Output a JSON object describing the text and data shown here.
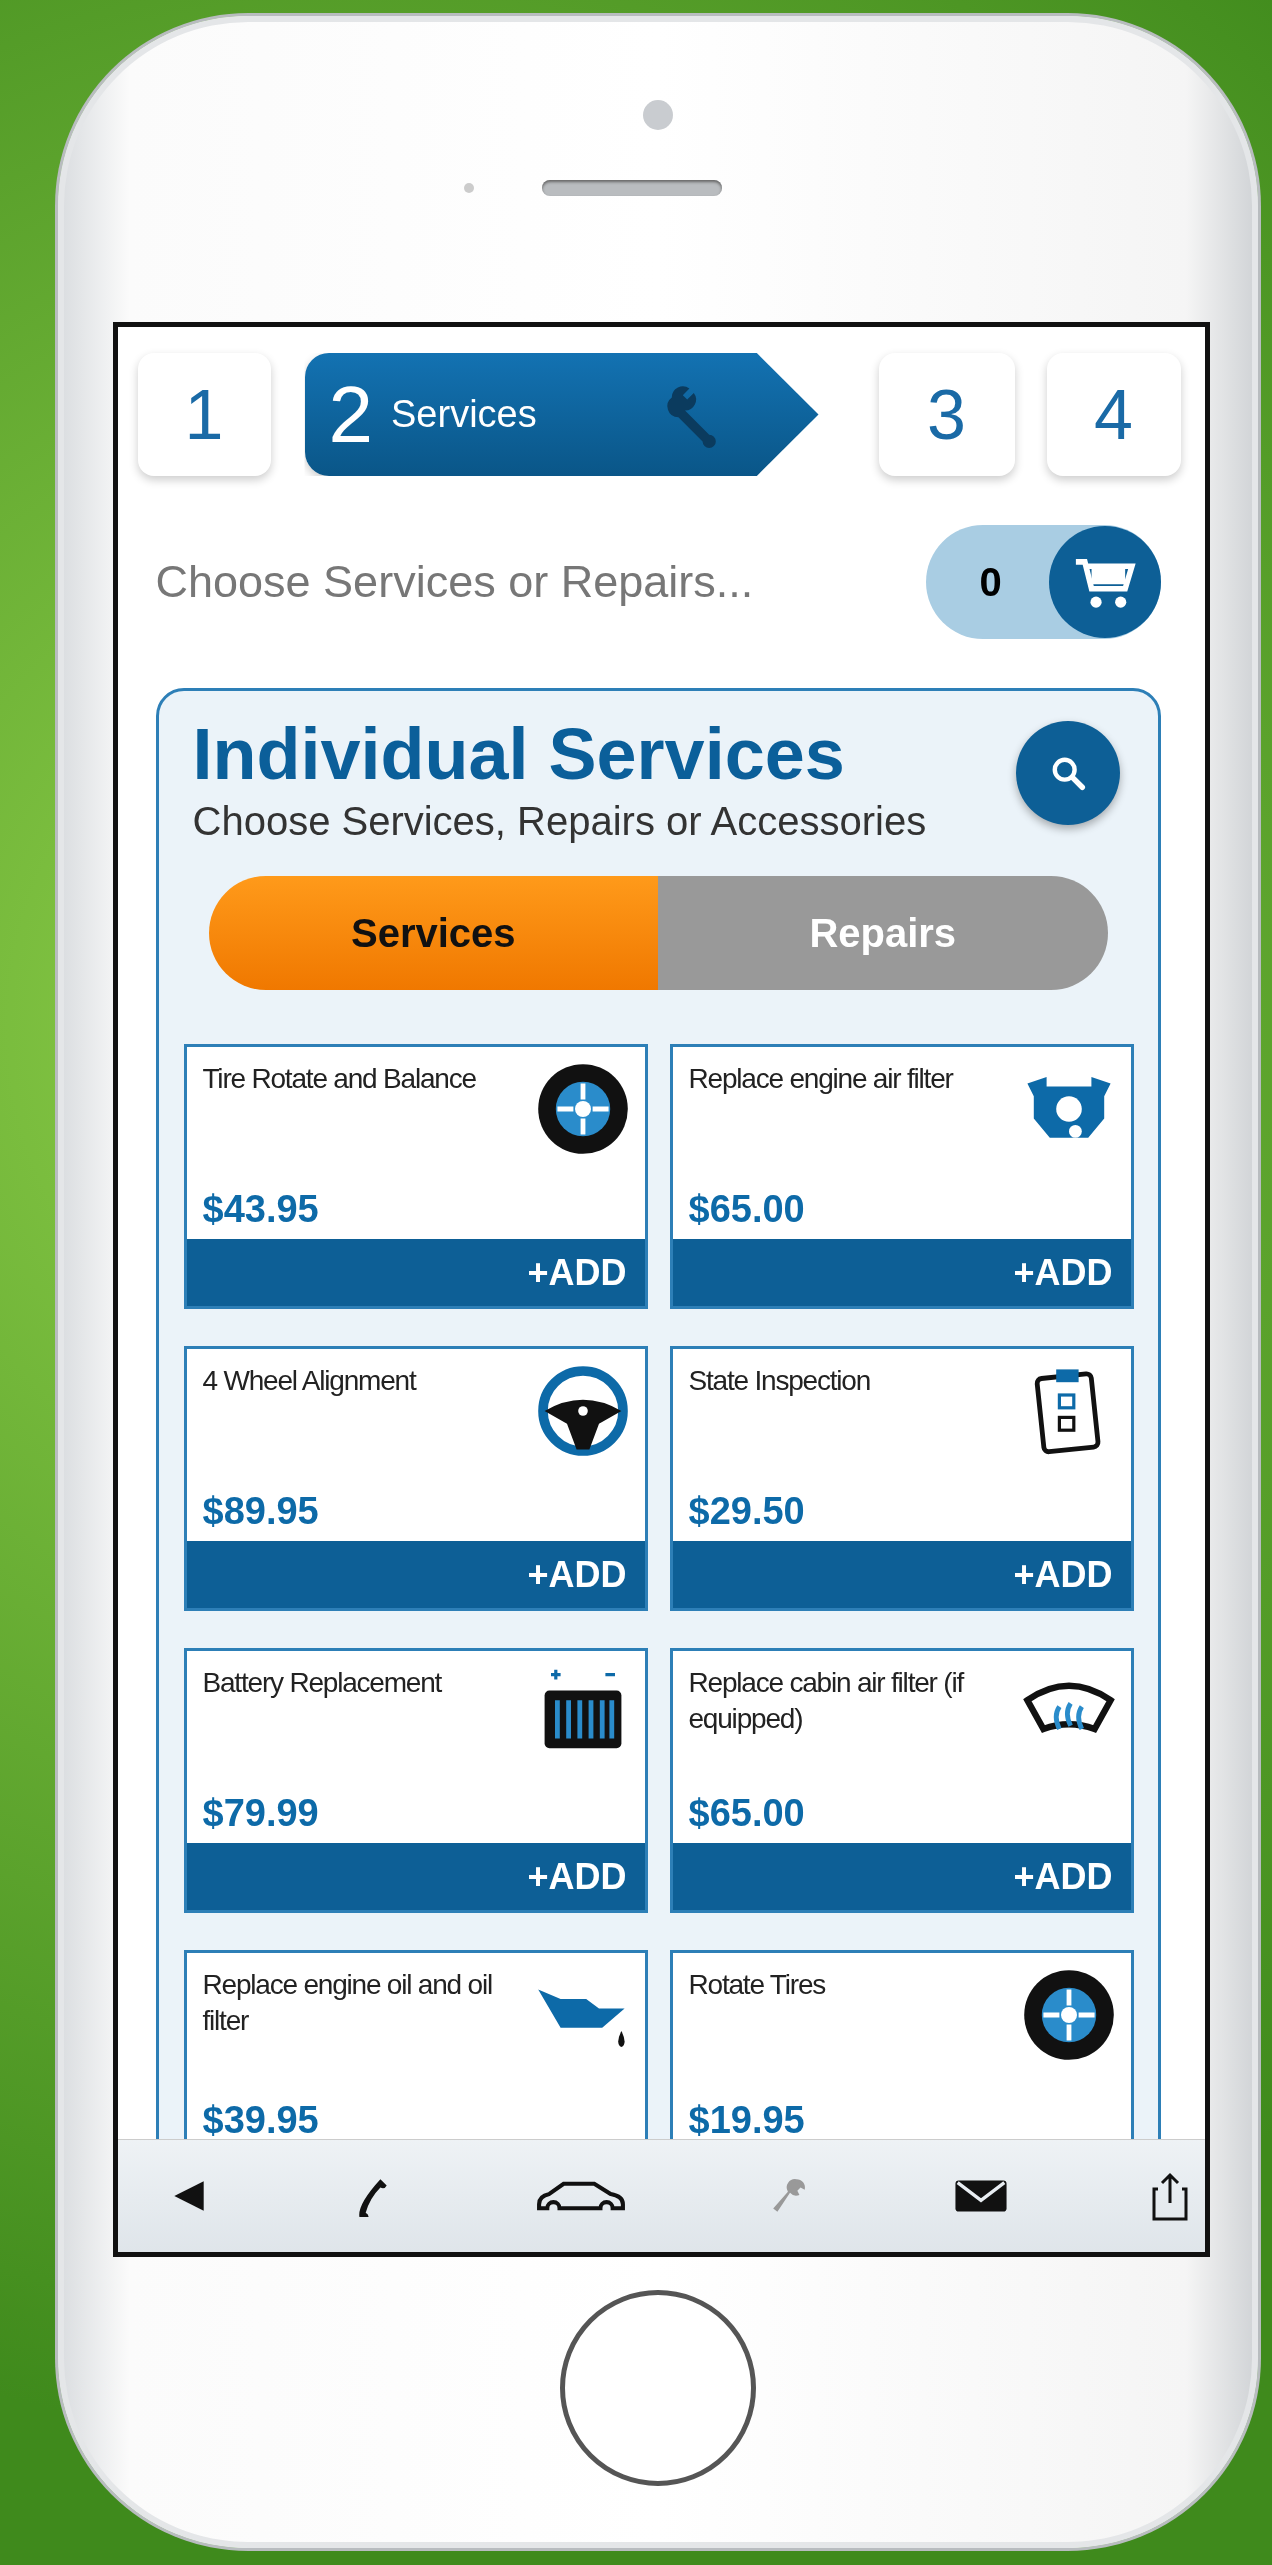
{
  "steps": [
    {
      "number": "1",
      "selected": false
    },
    {
      "number": "2",
      "label": "Services",
      "selected": true
    },
    {
      "number": "3",
      "selected": false
    },
    {
      "number": "4",
      "selected": false
    }
  ],
  "prompt": "Choose Services or Repairs...",
  "cart": {
    "count": "0"
  },
  "panel": {
    "title": "Individual Services",
    "subtitle": "Choose Services, Repairs or Accessories",
    "segments": [
      {
        "label": "Services",
        "selected": true
      },
      {
        "label": "Repairs",
        "selected": false
      }
    ],
    "cards": [
      {
        "title": "Tire Rotate and Balance",
        "price": "$43.95",
        "kind": "tire",
        "add": "+ADD"
      },
      {
        "title": "Replace engine air filter",
        "price": "$65.00",
        "kind": "engine",
        "add": "+ADD"
      },
      {
        "title": "4 Wheel Alignment",
        "price": "$89.95",
        "kind": "steering",
        "add": "+ADD"
      },
      {
        "title": "State Inspection",
        "price": "$29.50",
        "kind": "clipboard",
        "add": "+ADD"
      },
      {
        "title": "Battery Replacement",
        "price": "$79.99",
        "kind": "battery",
        "add": "+ADD"
      },
      {
        "title": "Replace cabin air filter (if equipped)",
        "price": "$65.00",
        "kind": "defrost",
        "add": "+ADD"
      },
      {
        "title": "Replace engine oil and oil filter",
        "price": "$39.95",
        "kind": "oil"
      },
      {
        "title": "Rotate Tires",
        "price": "$19.95",
        "kind": "tire"
      }
    ]
  },
  "toolbar": [
    {
      "kind": "back",
      "disabled": false
    },
    {
      "kind": "phone",
      "disabled": false
    },
    {
      "kind": "car",
      "disabled": false
    },
    {
      "kind": "wrench",
      "disabled": true
    },
    {
      "kind": "mail",
      "disabled": false
    },
    {
      "kind": "share",
      "disabled": false
    }
  ]
}
